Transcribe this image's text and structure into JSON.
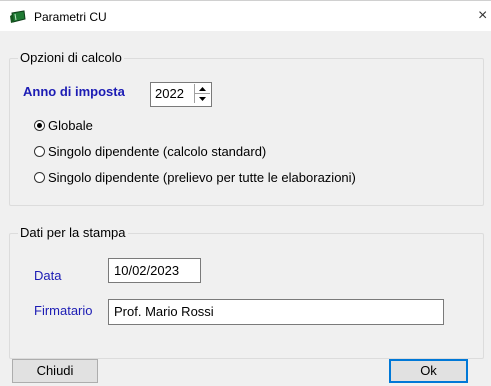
{
  "window": {
    "title": "Parametri CU",
    "close_glyph": "×",
    "icon": "app-icon"
  },
  "calc_options": {
    "group_title": "Opzioni di calcolo",
    "year_label": "Anno di imposta",
    "year_value": "2022",
    "radios": [
      {
        "label": "Globale",
        "checked": true
      },
      {
        "label": "Singolo dipendente (calcolo standard)",
        "checked": false
      },
      {
        "label": "Singolo dipendente (prelievo per tutte le elaborazioni)",
        "checked": false
      }
    ]
  },
  "print_data": {
    "group_title": "Dati per la stampa",
    "date_label": "Data",
    "date_value": "10/02/2023",
    "signer_label": "Firmatario",
    "signer_value": "Prof. Mario Rossi"
  },
  "buttons": {
    "close_label": "Chiudi",
    "ok_label": "Ok"
  },
  "colors": {
    "label_blue": "#1c1cb4",
    "background": "#f0f0f0",
    "icon_green": "#1f7a33"
  }
}
